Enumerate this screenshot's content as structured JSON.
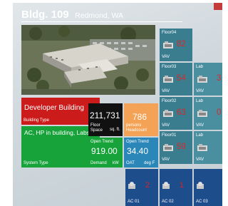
{
  "header": {
    "building": "Bldg. 109",
    "location": "Redmond, WA"
  },
  "tiles": {
    "building_name": {
      "value": "Developer Building",
      "label": "Building Type"
    },
    "system": {
      "value": "AC, HP in building, Labs",
      "label": "System Type"
    },
    "floor_space": {
      "value": "211,731",
      "label1": "Floor Space",
      "unit": "sq. ft."
    },
    "headcount": {
      "value": "786",
      "label1": "persons",
      "label2": "Headcount"
    },
    "demand": {
      "title": "Open Trend",
      "value": "919.00",
      "label": "Demand",
      "unit": "kW"
    },
    "oat": {
      "title": "Open Trend",
      "value": "34.40",
      "label": "OAT",
      "unit": "deg F"
    }
  },
  "vav_tiles": [
    {
      "floor": "Floor04",
      "value": "82",
      "type": "VAV"
    },
    {
      "floor": "Floor03",
      "value": "54",
      "type": "VAV"
    },
    {
      "floor": "Lab",
      "value": "3",
      "type": "VAV"
    },
    {
      "floor": "Floor02",
      "value": "63",
      "type": "VAV"
    },
    {
      "floor": "Lab",
      "value": "0",
      "type": "VAV"
    },
    {
      "floor": "Floor01",
      "value": "59",
      "type": "VAV"
    },
    {
      "floor": "Lab",
      "value": "",
      "type": "VAV"
    }
  ],
  "ac_tiles": [
    {
      "label": "AC 01",
      "value": "2"
    },
    {
      "label": "AC 02",
      "value": "1"
    },
    {
      "label": "AC 03",
      "value": ""
    }
  ],
  "colors": {
    "red_tile": "#cc1b1b",
    "green_tile": "#18a33a",
    "orange_tile": "#f4a255",
    "teal_tile": "#3a7d8f",
    "blue_tile": "#2c87b9",
    "navy_tile": "#1d4d8b",
    "alert_text": "#d42a2a"
  }
}
